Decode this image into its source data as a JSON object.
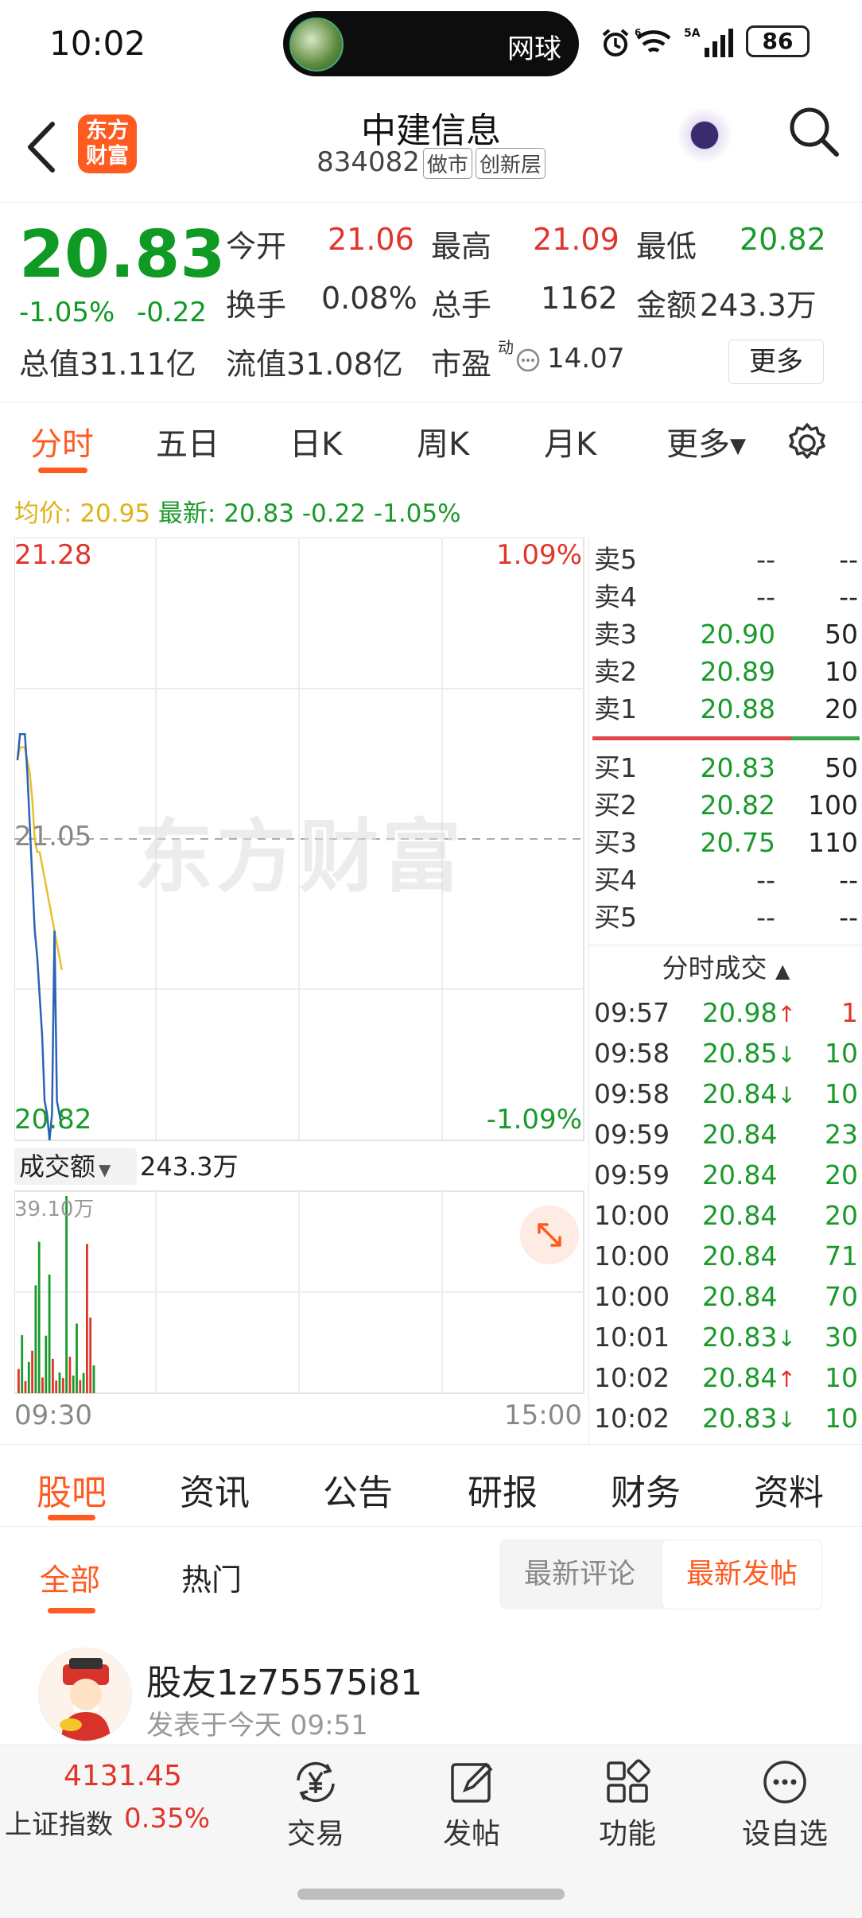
{
  "status": {
    "time": "10:02",
    "island_label": "网球",
    "battery": "86",
    "network": "5A"
  },
  "header": {
    "logo": "东方\n财富",
    "logo_line1": "东方",
    "logo_line2": "财富",
    "title": "中建信息",
    "code": "834082",
    "tag1": "做市",
    "tag2": "创新层"
  },
  "quote": {
    "price": "20.83",
    "change_pct": "-1.05%",
    "change_abs": "-0.22",
    "open_label": "今开",
    "open": "21.06",
    "high_label": "最高",
    "high": "21.09",
    "low_label": "最低",
    "low": "20.82",
    "turnover_label": "换手",
    "turnover": "0.08%",
    "volume_label": "总手",
    "volume": "1162",
    "amount_label": "金额",
    "amount": "243.3万",
    "mcap_label": "总值",
    "mcap": "31.11亿",
    "float_label": "流值",
    "float": "31.08亿",
    "pe_label": "市盈",
    "pe_sup": "动",
    "pe": "14.07",
    "more_label": "更多"
  },
  "chart_tabs": [
    "分时",
    "五日",
    "日K",
    "周K",
    "月K",
    "更多"
  ],
  "avg_line": {
    "avg_label": "均价:",
    "avg": "20.95",
    "latest_label": "最新:",
    "latest": "20.83",
    "chg": "-0.22",
    "pct": "-1.05%"
  },
  "chart_labels": {
    "top_price": "21.28",
    "top_pct": "1.09%",
    "mid_price": "21.05",
    "bottom_price": "20.82",
    "bottom_pct": "-1.09%",
    "watermark": "东方财富",
    "volume_selector": "成交额",
    "volume_value": "243.3万",
    "volume_max": "39.10万",
    "time_start": "09:30",
    "time_end": "15:00"
  },
  "chart_data": {
    "type": "line",
    "ylim": [
      20.82,
      21.28
    ],
    "series": [],
    "price": [
      21.11,
      21.13,
      21.13,
      21.13,
      21.1,
      21.06,
      21.02,
      20.98,
      20.96,
      20.93,
      20.9,
      20.85,
      20.84,
      20.82,
      20.84,
      20.98,
      20.85,
      20.84,
      20.83
    ],
    "avg": [
      21.11,
      21.12,
      21.12,
      21.12,
      21.11,
      21.1,
      21.08,
      21.05,
      21.04,
      21.04,
      21.03,
      21.02,
      21.01,
      21.0,
      20.99,
      20.98,
      20.97,
      20.96,
      20.95
    ],
    "volume_max_wan": 39.1,
    "volume_wan": [
      4.8,
      11.5,
      2.4,
      6.2,
      8.4,
      21.4,
      30.0,
      3.1,
      11.4,
      23.5,
      6.8,
      2.5,
      4.1,
      3.0,
      39.1,
      7.2,
      3.5,
      13.8,
      2.6,
      4.0,
      29.6,
      15.0,
      5.5
    ],
    "volume_color": [
      "r",
      "g",
      "r",
      "g",
      "r",
      "g",
      "g",
      "r",
      "g",
      "g",
      "r",
      "r",
      "g",
      "r",
      "g",
      "r",
      "g",
      "g",
      "r",
      "g",
      "r",
      "r",
      "g"
    ]
  },
  "order_book": {
    "sells": [
      {
        "label": "卖5",
        "price": "--",
        "vol": "--"
      },
      {
        "label": "卖4",
        "price": "--",
        "vol": "--"
      },
      {
        "label": "卖3",
        "price": "20.90",
        "vol": "50"
      },
      {
        "label": "卖2",
        "price": "20.89",
        "vol": "10"
      },
      {
        "label": "卖1",
        "price": "20.88",
        "vol": "20"
      }
    ],
    "buys": [
      {
        "label": "买1",
        "price": "20.83",
        "vol": "50"
      },
      {
        "label": "买2",
        "price": "20.82",
        "vol": "100"
      },
      {
        "label": "买3",
        "price": "20.75",
        "vol": "110"
      },
      {
        "label": "买4",
        "price": "--",
        "vol": "--"
      },
      {
        "label": "买5",
        "price": "--",
        "vol": "--"
      }
    ],
    "ticks_header": "分时成交",
    "ticks": [
      {
        "time": "09:57",
        "price": "20.98",
        "arrow": "↑",
        "vol": "1",
        "dir": "up"
      },
      {
        "time": "09:58",
        "price": "20.85",
        "arrow": "↓",
        "vol": "10",
        "dir": "down"
      },
      {
        "time": "09:58",
        "price": "20.84",
        "arrow": "↓",
        "vol": "10",
        "dir": "down"
      },
      {
        "time": "09:59",
        "price": "20.84",
        "arrow": "",
        "vol": "23",
        "dir": "down"
      },
      {
        "time": "09:59",
        "price": "20.84",
        "arrow": "",
        "vol": "20",
        "dir": "down"
      },
      {
        "time": "10:00",
        "price": "20.84",
        "arrow": "",
        "vol": "20",
        "dir": "down"
      },
      {
        "time": "10:00",
        "price": "20.84",
        "arrow": "",
        "vol": "71",
        "dir": "down"
      },
      {
        "time": "10:00",
        "price": "20.84",
        "arrow": "",
        "vol": "70",
        "dir": "down"
      },
      {
        "time": "10:01",
        "price": "20.83",
        "arrow": "↓",
        "vol": "30",
        "dir": "down"
      },
      {
        "time": "10:02",
        "price": "20.84",
        "arrow": "↑",
        "vol": "10",
        "dir": "down"
      },
      {
        "time": "10:02",
        "price": "20.83",
        "arrow": "↓",
        "vol": "10",
        "dir": "down"
      }
    ]
  },
  "news_tabs": [
    "股吧",
    "资讯",
    "公告",
    "研报",
    "财务",
    "资料"
  ],
  "filter": {
    "all": "全部",
    "hot": "热门",
    "sort_comment": "最新评论",
    "sort_post": "最新发帖"
  },
  "post": {
    "user": "股友1z75575i81",
    "time": "发表于今天 09:51"
  },
  "bottom_nav": {
    "index_value": "4131.45",
    "index_name": "上证指数",
    "index_pct": "0.35%",
    "trade": "交易",
    "post": "发帖",
    "functions": "功能",
    "watchlist": "设自选"
  },
  "colors": {
    "up": "#e0352b",
    "down": "#1a9a2a",
    "accent": "#ff5a1f",
    "avg": "#e8c02c",
    "price_line": "#2a63b8"
  }
}
